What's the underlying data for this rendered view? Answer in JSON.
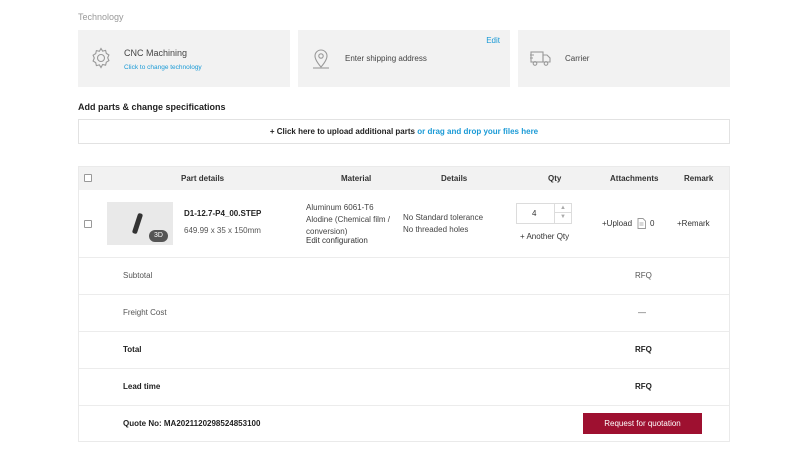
{
  "technology": {
    "section_label": "Technology",
    "card_technology": {
      "title": "CNC Machining",
      "subtitle": "Click to change technology",
      "icon": "gear-icon"
    },
    "card_shipping": {
      "title": "Enter shipping address",
      "edit_label": "Edit",
      "icon": "map-pin-icon"
    },
    "card_carrier": {
      "title": "Carrier",
      "icon": "truck-icon"
    }
  },
  "parts_section": {
    "title": "Add parts & change specifications",
    "upload_text": "+ Click here to upload additional parts",
    "drag_text": "or drag and drop your files here"
  },
  "table": {
    "headers": {
      "part_details": "Part details",
      "material": "Material",
      "details": "Details",
      "qty": "Qty",
      "attachments": "Attachments",
      "remark": "Remark"
    },
    "rows": [
      {
        "file_name": "D1-12.7-P4_00.STEP",
        "dimensions": "649.99 x 35 x 150mm",
        "badge": "3D",
        "material_line1": "Aluminum 6061-T6",
        "material_line2": "Alodine (Chemical film /",
        "material_line3": "conversion)",
        "edit_config": "Edit configuration",
        "detail_line1": "No Standard tolerance",
        "detail_line2": "No threaded holes",
        "qty": "4",
        "another_qty": "+ Another Qty",
        "upload_label": "+Upload",
        "attachment_count": "0",
        "remark_label": "+Remark"
      }
    ]
  },
  "summary": {
    "subtotal_label": "Subtotal",
    "subtotal_value": "RFQ",
    "freight_label": "Freight Cost",
    "freight_value": "—",
    "total_label": "Total",
    "total_value": "RFQ",
    "lead_label": "Lead time",
    "lead_value": "RFQ",
    "quote_label": "Quote No: MA2021120298524853100",
    "request_button": "Request for quotation"
  },
  "colors": {
    "accent_link": "#1a9ad6",
    "button_primary": "#9e1030",
    "card_bg": "#f2f2f2"
  }
}
